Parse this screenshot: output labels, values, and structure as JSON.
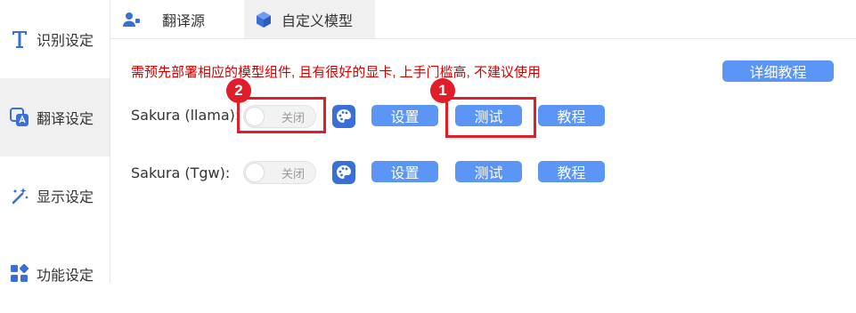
{
  "sidebar": {
    "items": [
      {
        "label": "识别设定"
      },
      {
        "label": "翻译设定"
      },
      {
        "label": "显示设定"
      },
      {
        "label": "功能设定"
      }
    ]
  },
  "tabs": [
    {
      "label": "翻译源"
    },
    {
      "label": "自定义模型"
    }
  ],
  "main": {
    "warning": "需预先部署相应的模型组件, 且有很好的显卡, 上手门槛高, 不建议使用",
    "detail_button": "详细教程",
    "rows": [
      {
        "label": "Sakura (llama):",
        "toggle": "关闭",
        "settings": "设置",
        "test": "测试",
        "tutorial": "教程"
      },
      {
        "label": "Sakura (Tgw):",
        "toggle": "关闭",
        "settings": "设置",
        "test": "测试",
        "tutorial": "教程"
      }
    ]
  },
  "annotations": {
    "marker1": "1",
    "marker2": "2"
  },
  "colors": {
    "accent": "#5b96f7",
    "warning": "#d40000",
    "annotation": "#e11d2a"
  }
}
